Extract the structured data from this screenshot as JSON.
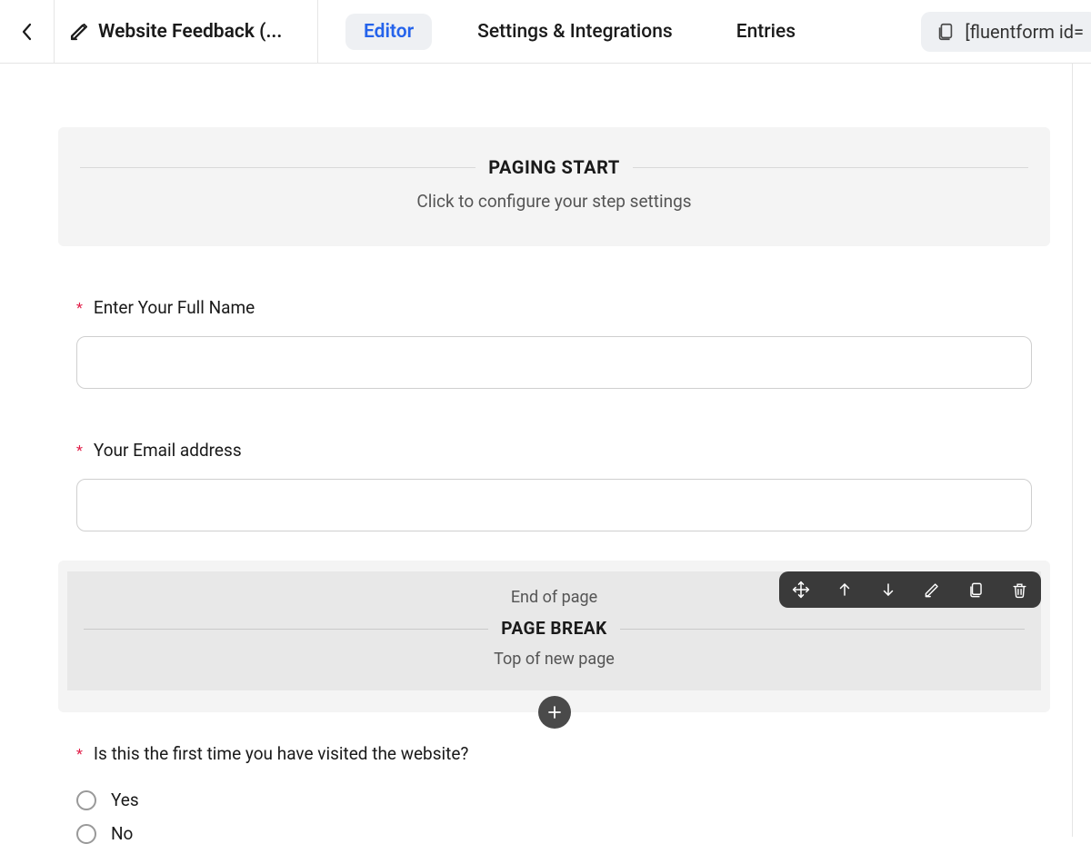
{
  "header": {
    "form_title": "Website Feedback (...",
    "tabs": {
      "editor": "Editor",
      "settings": "Settings & Integrations",
      "entries": "Entries"
    },
    "shortcode": "[fluentform id="
  },
  "paging_start": {
    "title": "PAGING START",
    "subtitle": "Click to configure your step settings"
  },
  "fields": {
    "name": {
      "label": "Enter Your Full Name"
    },
    "email": {
      "label": "Your Email address"
    }
  },
  "page_break": {
    "end": "End of page",
    "title": "PAGE BREAK",
    "top": "Top of new page"
  },
  "question": {
    "label": "Is this the first time you have visited the website?",
    "options": [
      "Yes",
      "No"
    ]
  }
}
